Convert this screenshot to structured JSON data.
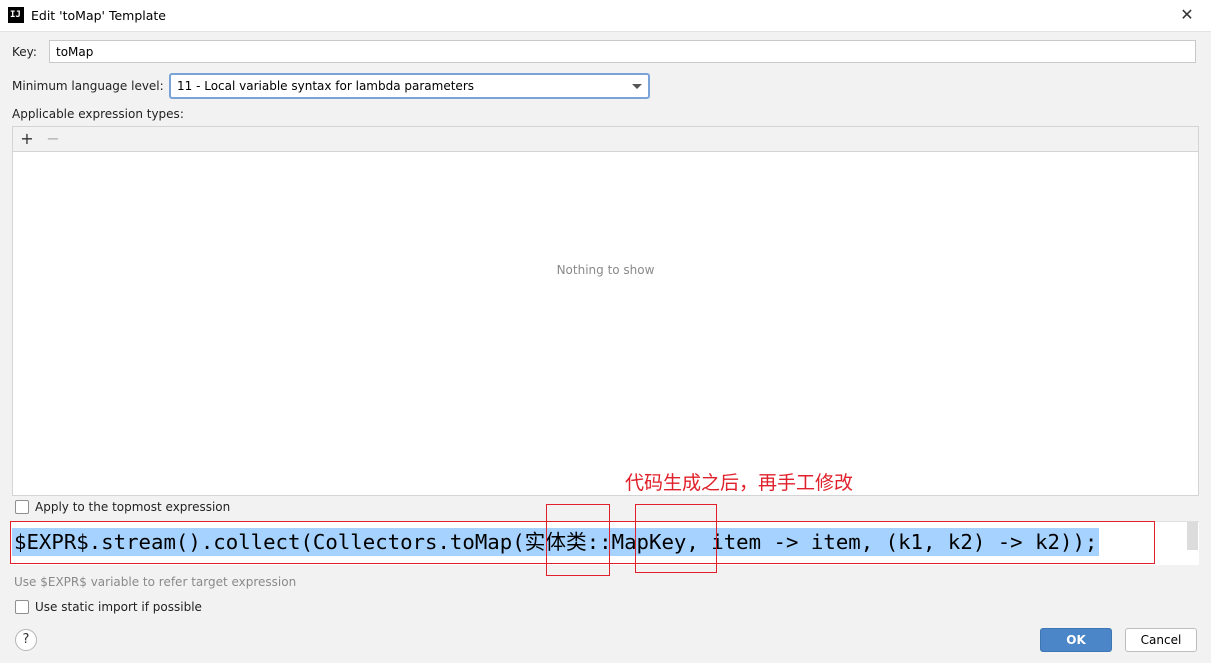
{
  "window": {
    "title": "Edit 'toMap' Template",
    "app_icon_text": "IJ"
  },
  "form": {
    "key_label": "Key:",
    "key_value": "toMap",
    "language_label": "Minimum language level:",
    "language_value": "11 - Local variable syntax for lambda parameters",
    "types_label": "Applicable expression types:",
    "types_empty": "Nothing to show",
    "add_symbol": "+",
    "remove_symbol": "−",
    "topmost_label": "Apply to the topmost expression",
    "topmost_checked": false,
    "hint": "Use $EXPR$ variable to refer target expression",
    "static_import_label": "Use static import if possible",
    "static_import_checked": false
  },
  "editor": {
    "code": "$EXPR$.stream().collect(Collectors.toMap(实体类::MapKey, item -> item, (k1, k2) -> k2));",
    "selection_color": "#a6d2ff"
  },
  "annotation": {
    "text": "代码生成之后，再手工修改",
    "color": "#e0202a"
  },
  "footer": {
    "help_label": "?",
    "ok_label": "OK",
    "cancel_label": "Cancel"
  }
}
